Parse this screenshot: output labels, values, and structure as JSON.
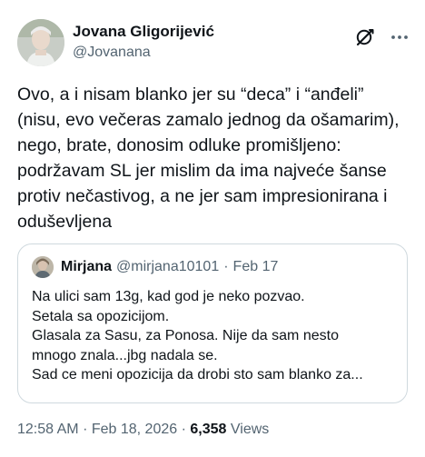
{
  "author": {
    "display_name": "Jovana Gligorijević",
    "handle": "@Jovanana"
  },
  "icons": {
    "grok": "grok-icon",
    "more": "more-dots-icon"
  },
  "tweet": {
    "text": "Ovo, a i nisam blanko jer su “deca” i “anđeli”\n(nisu, evo večeras zamalo jednog da ošamarim),\nnego, brate, donosim odluke promišljeno:\npodržavam SL jer mislim da ima najveće šanse\nprotiv nečastivog, a ne jer sam impresionirana i\noduševljena"
  },
  "quote": {
    "display_name": "Mirjana",
    "handle": "@mirjana10101",
    "separator": "·",
    "date": "Feb 17",
    "text": "Na ulici sam 13g, kad god je neko pozvao.\nSetala sa opozicijom.\nGlasala za Sasu, za Ponosa. Nije da sam nesto\nmnogo znala...jbg nadala se.\nSad ce meni opozicija  da drobi sto sam blanko za..."
  },
  "meta": {
    "time": "12:58 AM",
    "separator": "·",
    "date": "Feb 18, 2026",
    "views_count": "6,358",
    "views_label": "Views"
  },
  "colors": {
    "text_primary": "#0f1419",
    "text_secondary": "#536471",
    "border": "#cfd9de"
  }
}
